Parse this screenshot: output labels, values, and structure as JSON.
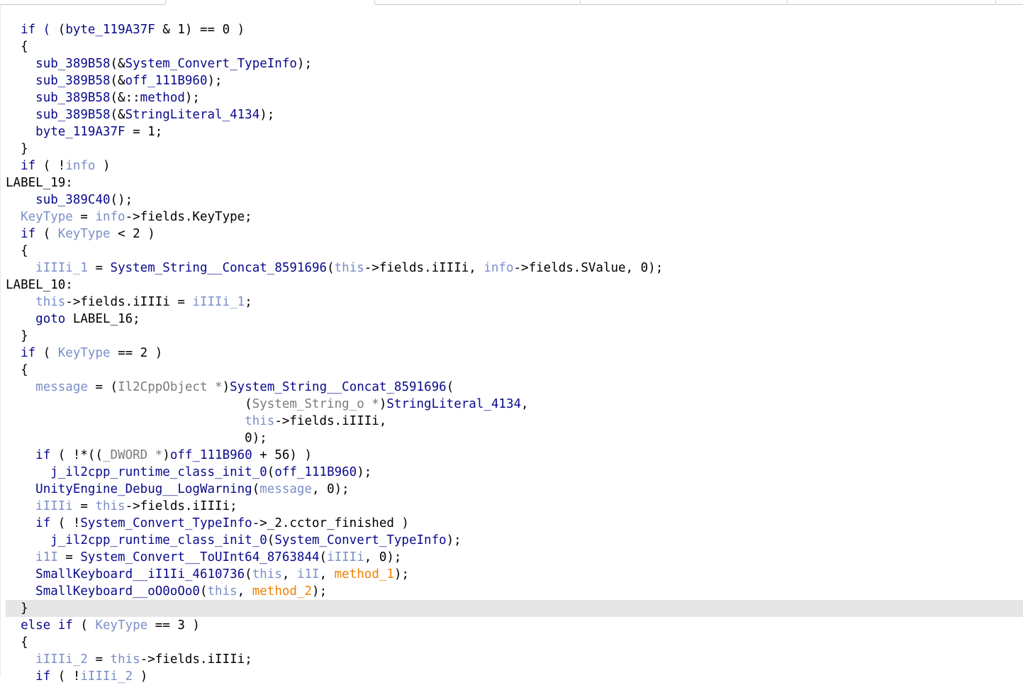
{
  "colors": {
    "keyword": "#0a0a8c",
    "function": "#0a0a8c",
    "local_variable": "#7b8fc8",
    "argument": "#f08000",
    "type_cast": "#7b7b7b",
    "punctuation": "#000000",
    "highlight_background": "#e6e6e6"
  },
  "code": {
    "highlighted_line": 34,
    "lines": [
      {
        "indent": "  ",
        "tokens": [
          [
            "k",
            "if ( "
          ],
          [
            "p",
            "("
          ],
          [
            "f",
            "byte_119A37F"
          ],
          [
            "p",
            " & 1) == 0 )"
          ]
        ]
      },
      {
        "indent": "  ",
        "tokens": [
          [
            "p",
            "{"
          ]
        ]
      },
      {
        "indent": "    ",
        "tokens": [
          [
            "f",
            "sub_389B58"
          ],
          [
            "p",
            "(&"
          ],
          [
            "f",
            "System_Convert_TypeInfo"
          ],
          [
            "p",
            ");"
          ]
        ]
      },
      {
        "indent": "    ",
        "tokens": [
          [
            "f",
            "sub_389B58"
          ],
          [
            "p",
            "(&"
          ],
          [
            "f",
            "off_111B960"
          ],
          [
            "p",
            ");"
          ]
        ]
      },
      {
        "indent": "    ",
        "tokens": [
          [
            "f",
            "sub_389B58"
          ],
          [
            "p",
            "(&::"
          ],
          [
            "f",
            "method"
          ],
          [
            "p",
            ");"
          ]
        ]
      },
      {
        "indent": "    ",
        "tokens": [
          [
            "f",
            "sub_389B58"
          ],
          [
            "p",
            "(&"
          ],
          [
            "f",
            "StringLiteral_4134"
          ],
          [
            "p",
            ");"
          ]
        ]
      },
      {
        "indent": "    ",
        "tokens": [
          [
            "f",
            "byte_119A37F"
          ],
          [
            "p",
            " = 1;"
          ]
        ]
      },
      {
        "indent": "  ",
        "tokens": [
          [
            "p",
            "}"
          ]
        ]
      },
      {
        "indent": "  ",
        "tokens": [
          [
            "k",
            "if"
          ],
          [
            "p",
            " ( !"
          ],
          [
            "v",
            "info"
          ],
          [
            "p",
            " )"
          ]
        ]
      },
      {
        "indent": "",
        "tokens": [
          [
            "l",
            "LABEL_19:"
          ]
        ]
      },
      {
        "indent": "    ",
        "tokens": [
          [
            "f",
            "sub_389C40"
          ],
          [
            "p",
            "();"
          ]
        ]
      },
      {
        "indent": "  ",
        "tokens": [
          [
            "v",
            "KeyType"
          ],
          [
            "p",
            " = "
          ],
          [
            "v",
            "info"
          ],
          [
            "p",
            "->fields.KeyType;"
          ]
        ]
      },
      {
        "indent": "  ",
        "tokens": [
          [
            "k",
            "if"
          ],
          [
            "p",
            " ( "
          ],
          [
            "v",
            "KeyType"
          ],
          [
            "p",
            " < 2 )"
          ]
        ]
      },
      {
        "indent": "  ",
        "tokens": [
          [
            "p",
            "{"
          ]
        ]
      },
      {
        "indent": "    ",
        "tokens": [
          [
            "v",
            "iIIIi_1"
          ],
          [
            "p",
            " = "
          ],
          [
            "f",
            "System_String__Concat_8591696"
          ],
          [
            "p",
            "("
          ],
          [
            "v",
            "this"
          ],
          [
            "p",
            "->fields.iIIIi, "
          ],
          [
            "v",
            "info"
          ],
          [
            "p",
            "->fields.SValue, 0);"
          ]
        ]
      },
      {
        "indent": "",
        "tokens": [
          [
            "l",
            "LABEL_10:"
          ]
        ]
      },
      {
        "indent": "    ",
        "tokens": [
          [
            "v",
            "this"
          ],
          [
            "p",
            "->fields.iIIIi = "
          ],
          [
            "v",
            "iIIIi_1"
          ],
          [
            "p",
            ";"
          ]
        ]
      },
      {
        "indent": "    ",
        "tokens": [
          [
            "k",
            "goto"
          ],
          [
            "p",
            " LABEL_16;"
          ]
        ]
      },
      {
        "indent": "  ",
        "tokens": [
          [
            "p",
            "}"
          ]
        ]
      },
      {
        "indent": "  ",
        "tokens": [
          [
            "k",
            "if"
          ],
          [
            "p",
            " ( "
          ],
          [
            "v",
            "KeyType"
          ],
          [
            "p",
            " == 2 )"
          ]
        ]
      },
      {
        "indent": "  ",
        "tokens": [
          [
            "p",
            "{"
          ]
        ]
      },
      {
        "indent": "    ",
        "tokens": [
          [
            "v",
            "message"
          ],
          [
            "p",
            " = ("
          ],
          [
            "t",
            "Il2CppObject *"
          ],
          [
            "p",
            ")"
          ],
          [
            "f",
            "System_String__Concat_8591696"
          ],
          [
            "p",
            "("
          ]
        ]
      },
      {
        "indent": "                                ",
        "tokens": [
          [
            "p",
            "("
          ],
          [
            "t",
            "System_String_o *"
          ],
          [
            "p",
            ")"
          ],
          [
            "f",
            "StringLiteral_4134"
          ],
          [
            "p",
            ","
          ]
        ]
      },
      {
        "indent": "                                ",
        "tokens": [
          [
            "v",
            "this"
          ],
          [
            "p",
            "->fields.iIIIi,"
          ]
        ]
      },
      {
        "indent": "                                ",
        "tokens": [
          [
            "p",
            "0);"
          ]
        ]
      },
      {
        "indent": "    ",
        "tokens": [
          [
            "k",
            "if"
          ],
          [
            "p",
            " ( !*(("
          ],
          [
            "t",
            "_DWORD *"
          ],
          [
            "p",
            ")"
          ],
          [
            "f",
            "off_111B960"
          ],
          [
            "p",
            " + 56) )"
          ]
        ]
      },
      {
        "indent": "      ",
        "tokens": [
          [
            "f",
            "j_il2cpp_runtime_class_init_0"
          ],
          [
            "p",
            "("
          ],
          [
            "f",
            "off_111B960"
          ],
          [
            "p",
            ");"
          ]
        ]
      },
      {
        "indent": "    ",
        "tokens": [
          [
            "f",
            "UnityEngine_Debug__LogWarning"
          ],
          [
            "p",
            "("
          ],
          [
            "v",
            "message"
          ],
          [
            "p",
            ", 0);"
          ]
        ]
      },
      {
        "indent": "    ",
        "tokens": [
          [
            "v",
            "iIIIi"
          ],
          [
            "p",
            " = "
          ],
          [
            "v",
            "this"
          ],
          [
            "p",
            "->fields.iIIIi;"
          ]
        ]
      },
      {
        "indent": "    ",
        "tokens": [
          [
            "k",
            "if"
          ],
          [
            "p",
            " ( !"
          ],
          [
            "f",
            "System_Convert_TypeInfo"
          ],
          [
            "p",
            "->_2.cctor_finished )"
          ]
        ]
      },
      {
        "indent": "      ",
        "tokens": [
          [
            "f",
            "j_il2cpp_runtime_class_init_0"
          ],
          [
            "p",
            "("
          ],
          [
            "f",
            "System_Convert_TypeInfo"
          ],
          [
            "p",
            ");"
          ]
        ]
      },
      {
        "indent": "    ",
        "tokens": [
          [
            "v",
            "i1I"
          ],
          [
            "p",
            " = "
          ],
          [
            "f",
            "System_Convert__ToUInt64_8763844"
          ],
          [
            "p",
            "("
          ],
          [
            "v",
            "iIIIi"
          ],
          [
            "p",
            ", 0);"
          ]
        ]
      },
      {
        "indent": "    ",
        "tokens": [
          [
            "f",
            "SmallKeyboard__iI1Ii_4610736"
          ],
          [
            "p",
            "("
          ],
          [
            "v",
            "this"
          ],
          [
            "p",
            ", "
          ],
          [
            "v",
            "i1I"
          ],
          [
            "p",
            ", "
          ],
          [
            "a",
            "method_1"
          ],
          [
            "p",
            ");"
          ]
        ]
      },
      {
        "indent": "    ",
        "tokens": [
          [
            "f",
            "SmallKeyboard__oO0oOo0"
          ],
          [
            "p",
            "("
          ],
          [
            "v",
            "this"
          ],
          [
            "p",
            ", "
          ],
          [
            "a",
            "method_2"
          ],
          [
            "p",
            ");"
          ]
        ]
      },
      {
        "indent": "  ",
        "tokens": [
          [
            "p",
            "}"
          ]
        ]
      },
      {
        "indent": "  ",
        "tokens": [
          [
            "k",
            "else if"
          ],
          [
            "p",
            " ( "
          ],
          [
            "v",
            "KeyType"
          ],
          [
            "p",
            " == 3 )"
          ]
        ]
      },
      {
        "indent": "  ",
        "tokens": [
          [
            "p",
            "{"
          ]
        ]
      },
      {
        "indent": "    ",
        "tokens": [
          [
            "v",
            "iIIIi_2"
          ],
          [
            "p",
            " = "
          ],
          [
            "v",
            "this"
          ],
          [
            "p",
            "->fields.iIIIi;"
          ]
        ]
      },
      {
        "indent": "    ",
        "tokens": [
          [
            "k",
            "if"
          ],
          [
            "p",
            " ( !"
          ],
          [
            "v",
            "iIIIi_2"
          ],
          [
            "p",
            " )"
          ]
        ]
      }
    ]
  }
}
